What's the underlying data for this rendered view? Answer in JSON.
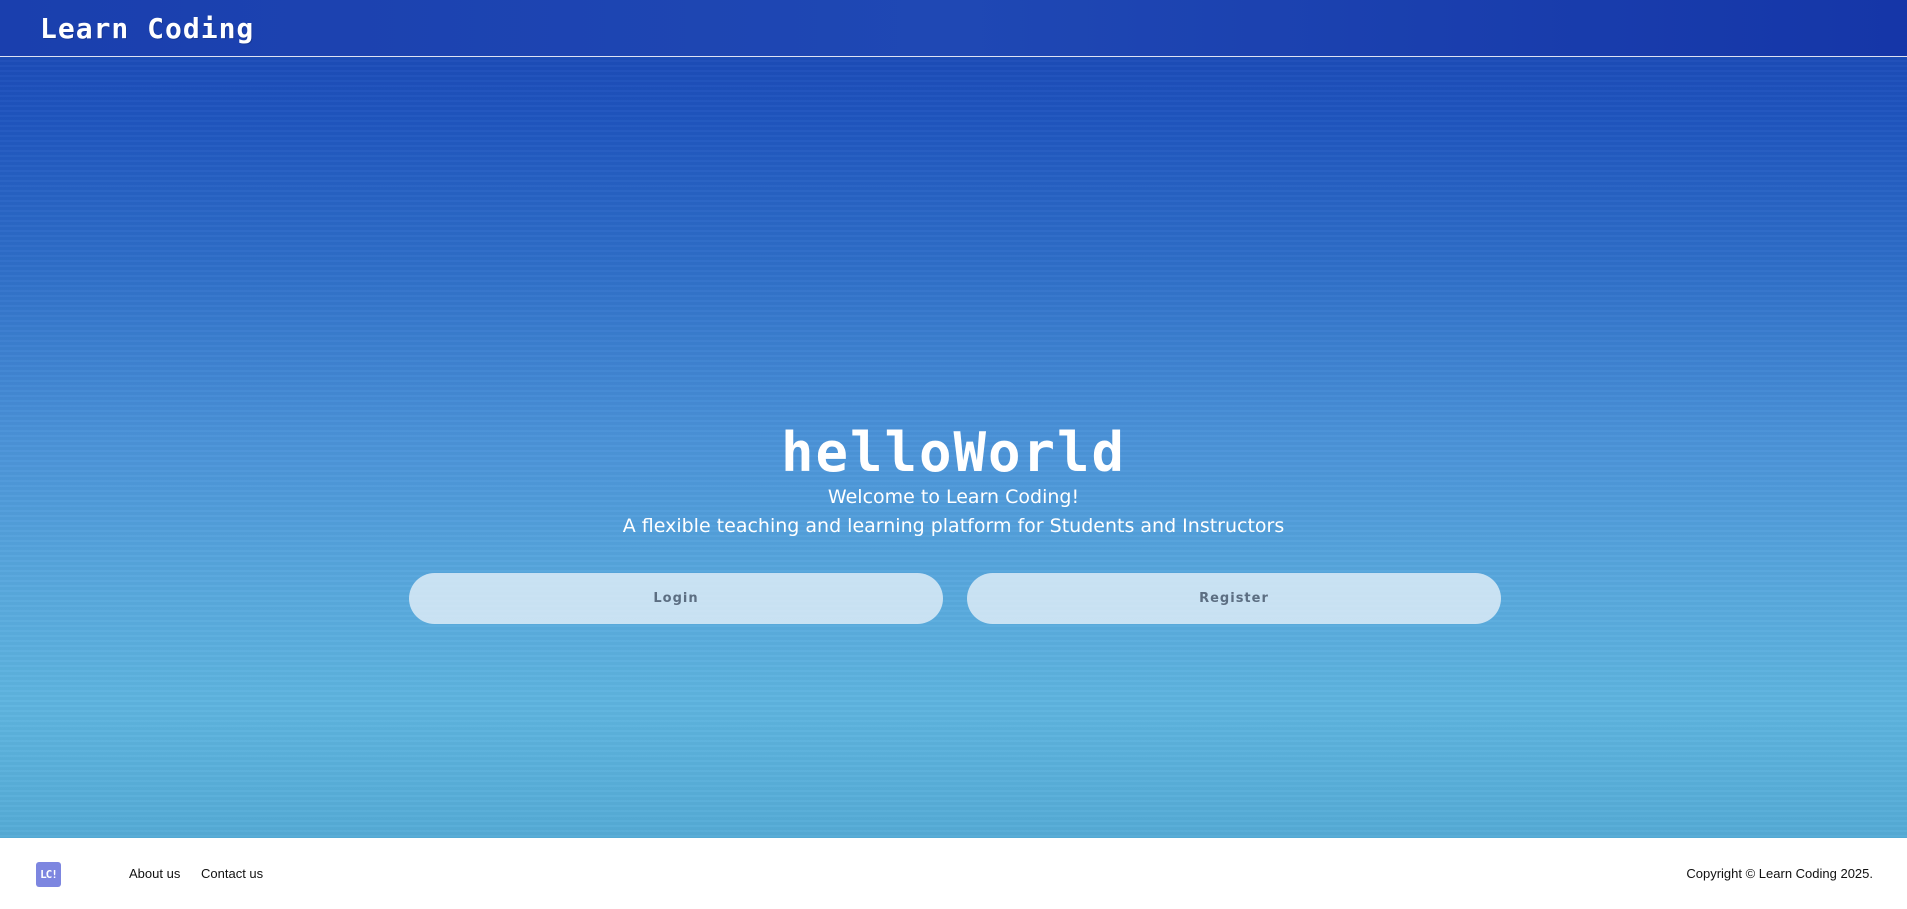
{
  "header": {
    "brand": "Learn Coding"
  },
  "hero": {
    "title": "helloWorld",
    "welcome": "Welcome to Learn Coding!",
    "tagline": "A flexible teaching and learning platform for Students and Instructors",
    "login_label": "Login",
    "register_label": "Register"
  },
  "footer": {
    "logo_text": "LC!",
    "links": [
      {
        "label": "About us"
      },
      {
        "label": "Contact us"
      }
    ],
    "copyright": "Copyright © Learn Coding 2025."
  },
  "colors": {
    "hero_top": "#1a44b2",
    "hero_bottom": "#5eb4df",
    "button_bg": "#e2eef8",
    "button_text": "#5c6e82",
    "logo_bg": "#7d86e0"
  }
}
